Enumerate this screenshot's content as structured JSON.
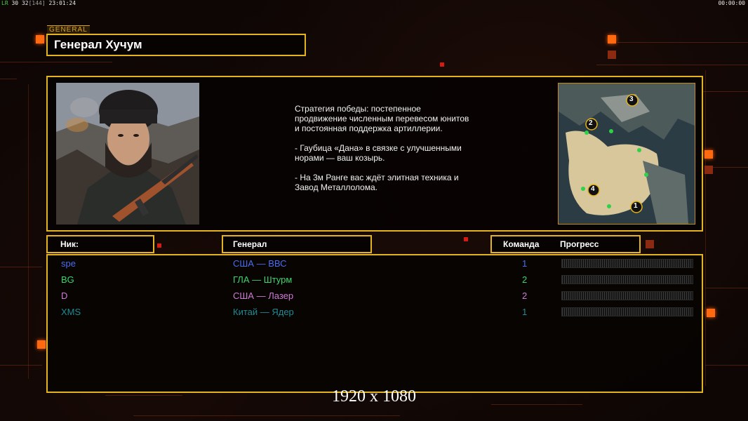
{
  "osd": {
    "fps_label": "LR",
    "fps_value": "30",
    "fps_cap": "32",
    "frame_count": "[144]",
    "clock": "23:01:24",
    "timer": "00:00:00"
  },
  "header": {
    "tag": "GENERAL",
    "title": "Генерал Хучум"
  },
  "general_info": {
    "portrait_icon": "general-portrait",
    "strategy_text": "Стратегия победы: постепенное продвижение численным перевесом юнитов и постоянная поддержка артиллерии.\n\n- Гаубица «Дана» в связке с улучшенными норами — ваш козырь.\n\n- На 3м Ранге вас ждёт элитная техника и Завод Металлолома.",
    "map_icon": "minimap",
    "map_markers": [
      "1",
      "2",
      "3",
      "4"
    ]
  },
  "columns": {
    "nick": "Ник:",
    "general": "Генерал",
    "team": "Команда",
    "progress": "Прогресс"
  },
  "players": [
    {
      "nick": "spe",
      "general": "США — ВВС",
      "team": "1",
      "color": "#4a6cf2",
      "progress": 0
    },
    {
      "nick": "BG",
      "general": "ГЛА — Штурм",
      "team": "2",
      "color": "#3ed66a",
      "progress": 0
    },
    {
      "nick": "D",
      "general": "США — Лазер",
      "team": "2",
      "color": "#d07ad8",
      "progress": 0
    },
    {
      "nick": "XMS",
      "general": "Китай — Ядер",
      "team": "1",
      "color": "#1f8a95",
      "progress": 0
    }
  ],
  "colors": {
    "accent": "#e3b41d",
    "orange_decor": "#ff6a10"
  },
  "footer": {
    "resolution": "1920 x 1080"
  }
}
